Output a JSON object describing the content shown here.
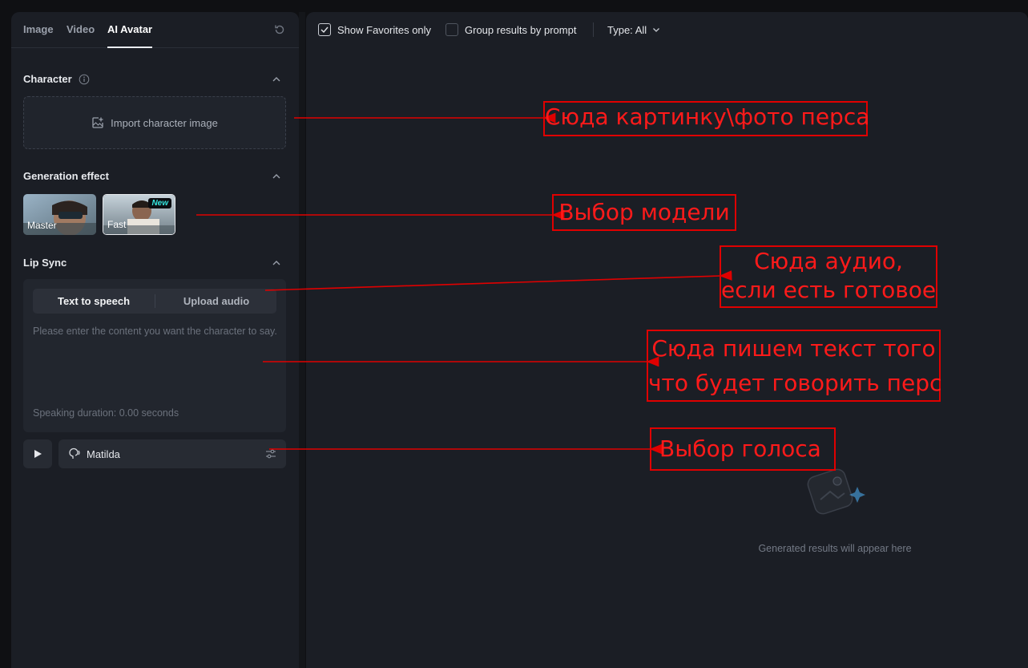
{
  "tabs": [
    {
      "label": "Image"
    },
    {
      "label": "Video"
    },
    {
      "label": "AI Avatar"
    }
  ],
  "sections": {
    "character": {
      "title": "Character",
      "import_label": "Import character image"
    },
    "generation": {
      "title": "Generation effect",
      "models": [
        {
          "label": "Master"
        },
        {
          "label": "Fast",
          "badge": "New"
        }
      ]
    },
    "lip_sync": {
      "title": "Lip Sync",
      "modes": [
        "Text to speech",
        "Upload audio"
      ],
      "placeholder": "Please enter the content you want the character to say.",
      "duration": "Speaking duration: 0.00 seconds"
    },
    "voice": {
      "name": "Matilda"
    }
  },
  "toolbar": {
    "favorites_label": "Show Favorites only",
    "group_label": "Group results by prompt",
    "type_label": "Type: All"
  },
  "empty_state": {
    "text": "Generated results will appear here"
  },
  "annotations": [
    {
      "text": "Сюда картинку\\фото перса"
    },
    {
      "text": "Выбор модели"
    },
    {
      "line1": "Сюда аудио,",
      "line2": "если есть готовое"
    },
    {
      "line1": "Сюда пишем текст того",
      "line2": "что будет говорить перс"
    },
    {
      "text": "Выбор голоса"
    }
  ],
  "colors": {
    "annotation": "#e00000",
    "panel": "#1b1e25",
    "background": "#0f1013",
    "badge": "#36e6e0"
  }
}
